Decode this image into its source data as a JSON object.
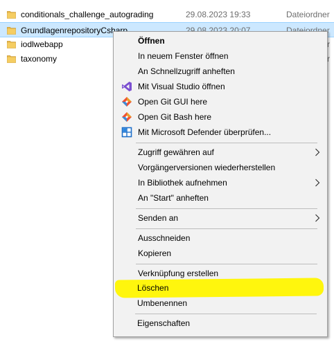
{
  "files": [
    {
      "name": "conditionals_challenge_autograding",
      "date": "29.08.2023 19:33",
      "type": "Dateiordner"
    },
    {
      "name": "GrundlagenrepositoryCsharp",
      "date": "29.08.2023 20:07",
      "type": "Dateiordner"
    },
    {
      "name": "iodlwebapp",
      "date": "",
      "type": "r"
    },
    {
      "name": "taxonomy",
      "date": "",
      "type": "r"
    }
  ],
  "context_menu": {
    "open": "Öffnen",
    "open_new_window": "In neuem Fenster öffnen",
    "pin_quick_access": "An Schnellzugriff anheften",
    "open_visual_studio": "Mit Visual Studio öffnen",
    "git_gui": "Open Git GUI here",
    "git_bash": "Open Git Bash here",
    "defender_scan": "Mit Microsoft Defender überprüfen...",
    "grant_access": "Zugriff gewähren auf",
    "restore_previous": "Vorgängerversionen wiederherstellen",
    "include_library": "In Bibliothek aufnehmen",
    "pin_start": "An \"Start\" anheften",
    "send_to": "Senden an",
    "cut": "Ausschneiden",
    "copy": "Kopieren",
    "create_shortcut": "Verknüpfung erstellen",
    "delete": "Löschen",
    "rename": "Umbenennen",
    "properties": "Eigenschaften"
  },
  "colors": {
    "selection": "#cce8ff",
    "menu_background": "#f2f2f2",
    "highlight": "#fff500",
    "folder": "#e8b84a"
  },
  "icons": [
    "folder-icon",
    "visual-studio-icon",
    "git-icon",
    "defender-icon",
    "chevron-right-icon"
  ]
}
